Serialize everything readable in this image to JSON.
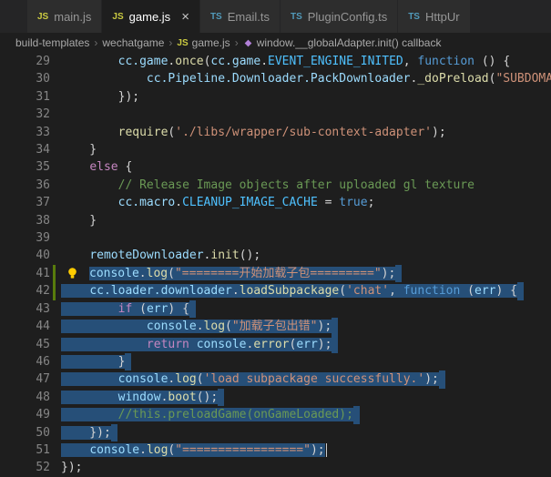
{
  "colors": {
    "selection": "#264f78",
    "git_added": "#587c0c",
    "js_icon": "#cbcb41",
    "ts_icon": "#519aba",
    "lightbulb": "#ffcc00"
  },
  "tabs": [
    {
      "label": "main.js",
      "icon": "JS",
      "active": false
    },
    {
      "label": "game.js",
      "icon": "JS",
      "active": true,
      "close": "×"
    },
    {
      "label": "Email.ts",
      "icon": "TS",
      "active": false
    },
    {
      "label": "PluginConfig.ts",
      "icon": "TS",
      "active": false
    },
    {
      "label": "HttpUr",
      "icon": "TS",
      "active": false
    }
  ],
  "breadcrumb": {
    "separator": "›",
    "items": [
      {
        "label": "build-templates"
      },
      {
        "label": "wechatgame"
      },
      {
        "label": "game.js",
        "icon": "JS"
      },
      {
        "label": "window.__globalAdapter.init() callback",
        "icon": "symbol"
      }
    ]
  },
  "editor": {
    "lines": [
      {
        "n": 29,
        "tokens": [
          [
            "pln",
            "        "
          ],
          [
            "vr",
            "cc.game"
          ],
          [
            "pln",
            "."
          ],
          [
            "fn",
            "once"
          ],
          [
            "pln",
            "("
          ],
          [
            "vr",
            "cc.game"
          ],
          [
            "pln",
            "."
          ],
          [
            "cn",
            "EVENT_ENGINE_INITED"
          ],
          [
            "pln",
            ", "
          ],
          [
            "kw",
            "function"
          ],
          [
            "pln",
            " () {"
          ]
        ]
      },
      {
        "n": 30,
        "tokens": [
          [
            "pln",
            "            "
          ],
          [
            "vr",
            "cc.Pipeline.Downloader.PackDownloader"
          ],
          [
            "pln",
            "."
          ],
          [
            "fn",
            "_doPreload"
          ],
          [
            "pln",
            "("
          ],
          [
            "str",
            "\"SUBDOMA"
          ]
        ]
      },
      {
        "n": 31,
        "tokens": [
          [
            "pln",
            "        });"
          ]
        ]
      },
      {
        "n": 32,
        "tokens": []
      },
      {
        "n": 33,
        "tokens": [
          [
            "pln",
            "        "
          ],
          [
            "fn",
            "require"
          ],
          [
            "pln",
            "("
          ],
          [
            "str",
            "'./libs/wrapper/sub-context-adapter'"
          ],
          [
            "pln",
            ");"
          ]
        ]
      },
      {
        "n": 34,
        "tokens": [
          [
            "pln",
            "    }"
          ]
        ]
      },
      {
        "n": 35,
        "tokens": [
          [
            "pln",
            "    "
          ],
          [
            "ctl",
            "else"
          ],
          [
            "pln",
            " {"
          ]
        ]
      },
      {
        "n": 36,
        "tokens": [
          [
            "pln",
            "        "
          ],
          [
            "com",
            "// Release Image objects after uploaded gl texture"
          ]
        ]
      },
      {
        "n": 37,
        "tokens": [
          [
            "pln",
            "        "
          ],
          [
            "vr",
            "cc.macro"
          ],
          [
            "pln",
            "."
          ],
          [
            "cn",
            "CLEANUP_IMAGE_CACHE"
          ],
          [
            "pln",
            " = "
          ],
          [
            "kw",
            "true"
          ],
          [
            "pln",
            ";"
          ]
        ]
      },
      {
        "n": 38,
        "tokens": [
          [
            "pln",
            "    }"
          ]
        ]
      },
      {
        "n": 39,
        "tokens": []
      },
      {
        "n": 40,
        "tokens": [
          [
            "pln",
            "    "
          ],
          [
            "vr",
            "remoteDownloader"
          ],
          [
            "pln",
            "."
          ],
          [
            "fn",
            "init"
          ],
          [
            "pln",
            "();"
          ]
        ]
      },
      {
        "n": 41,
        "lightbulb": true,
        "changed": true,
        "selected": true,
        "selpad": true,
        "tokens": [
          [
            "vr",
            "console"
          ],
          [
            "pln",
            "."
          ],
          [
            "fn",
            "log"
          ],
          [
            "pln",
            "("
          ],
          [
            "str",
            "\"========开始加载子包=========\""
          ],
          [
            "pln",
            ");"
          ]
        ]
      },
      {
        "n": 42,
        "changed": true,
        "selected": true,
        "selpad": true,
        "tokens": [
          [
            "pln",
            "    "
          ],
          [
            "vr",
            "cc.loader.downloader"
          ],
          [
            "pln",
            "."
          ],
          [
            "fn",
            "loadSubpackage"
          ],
          [
            "pln",
            "("
          ],
          [
            "str",
            "'chat'"
          ],
          [
            "pln",
            ", "
          ],
          [
            "kw",
            "function"
          ],
          [
            "pln",
            " ("
          ],
          [
            "vr",
            "err"
          ],
          [
            "pln",
            ") {"
          ]
        ]
      },
      {
        "n": 43,
        "selected": true,
        "selpad": true,
        "tokens": [
          [
            "pln",
            "        "
          ],
          [
            "ctl",
            "if"
          ],
          [
            "pln",
            " ("
          ],
          [
            "vr",
            "err"
          ],
          [
            "pln",
            ") {"
          ]
        ]
      },
      {
        "n": 44,
        "selected": true,
        "selpad": true,
        "tokens": [
          [
            "pln",
            "            "
          ],
          [
            "vr",
            "console"
          ],
          [
            "pln",
            "."
          ],
          [
            "fn",
            "log"
          ],
          [
            "pln",
            "("
          ],
          [
            "str",
            "\"加载子包出错\""
          ],
          [
            "pln",
            ");"
          ]
        ]
      },
      {
        "n": 45,
        "selected": true,
        "selpad": true,
        "tokens": [
          [
            "pln",
            "            "
          ],
          [
            "ctl",
            "return"
          ],
          [
            "pln",
            " "
          ],
          [
            "vr",
            "console"
          ],
          [
            "pln",
            "."
          ],
          [
            "fn",
            "error"
          ],
          [
            "pln",
            "("
          ],
          [
            "vr",
            "err"
          ],
          [
            "pln",
            ");"
          ]
        ]
      },
      {
        "n": 46,
        "selected": true,
        "selpad": true,
        "tokens": [
          [
            "pln",
            "        }"
          ]
        ]
      },
      {
        "n": 47,
        "selected": true,
        "selpad": true,
        "tokens": [
          [
            "pln",
            "        "
          ],
          [
            "vr",
            "console"
          ],
          [
            "pln",
            "."
          ],
          [
            "fn",
            "log"
          ],
          [
            "pln",
            "("
          ],
          [
            "str",
            "'load subpackage successfully.'"
          ],
          [
            "pln",
            ");"
          ]
        ]
      },
      {
        "n": 48,
        "selected": true,
        "selpad": true,
        "tokens": [
          [
            "pln",
            "        "
          ],
          [
            "vr",
            "window"
          ],
          [
            "pln",
            "."
          ],
          [
            "fn",
            "boot"
          ],
          [
            "pln",
            "();"
          ]
        ]
      },
      {
        "n": 49,
        "selected": true,
        "selpad": true,
        "tokens": [
          [
            "pln",
            "        "
          ],
          [
            "com",
            "//this.preloadGame(onGameLoaded);"
          ]
        ]
      },
      {
        "n": 50,
        "selected": true,
        "selpad": true,
        "tokens": [
          [
            "pln",
            "    });"
          ]
        ]
      },
      {
        "n": 51,
        "selected": true,
        "cursor": true,
        "tokens": [
          [
            "pln",
            "    "
          ],
          [
            "vr",
            "console"
          ],
          [
            "pln",
            "."
          ],
          [
            "fn",
            "log"
          ],
          [
            "pln",
            "("
          ],
          [
            "str",
            "\"=================\""
          ],
          [
            "pln",
            ");"
          ]
        ]
      },
      {
        "n": 52,
        "tokens": [
          [
            "pln",
            "});"
          ]
        ]
      }
    ]
  }
}
